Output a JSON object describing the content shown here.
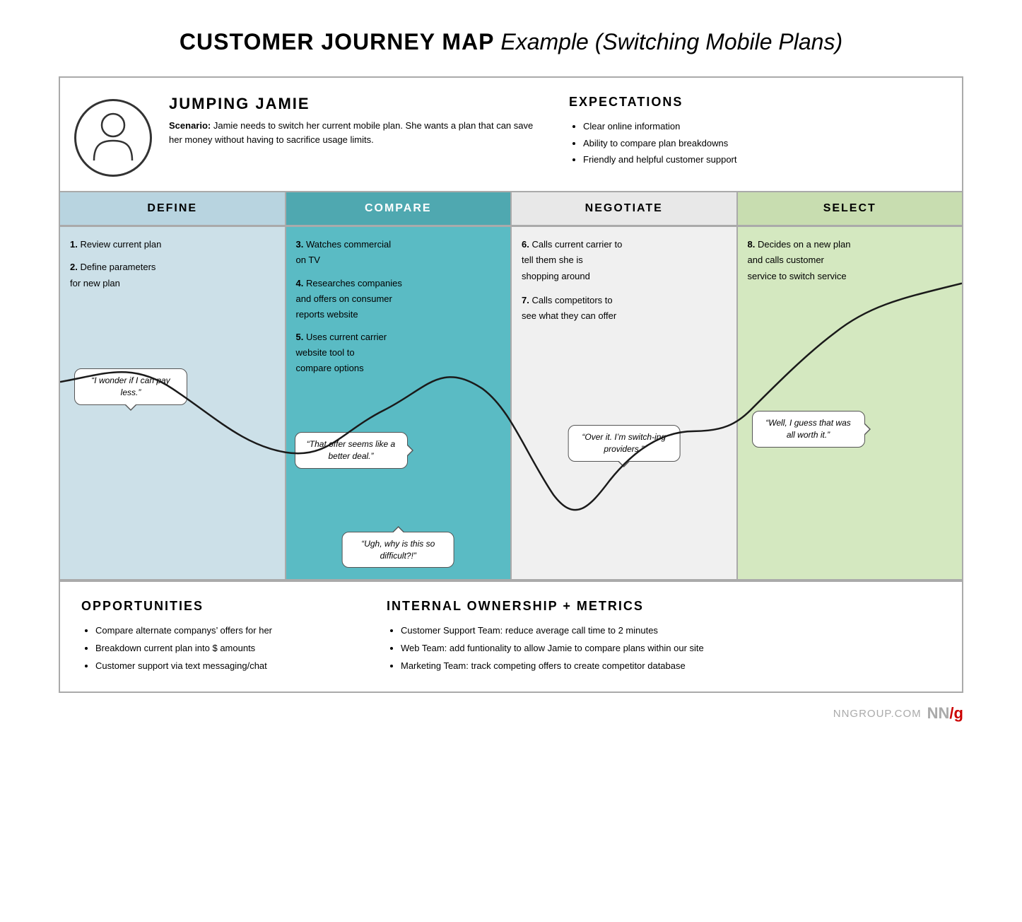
{
  "title": {
    "bold": "CUSTOMER JOURNEY MAP",
    "italic": "Example (Switching Mobile Plans)"
  },
  "persona": {
    "name": "JUMPING JAMIE",
    "scenario_label": "Scenario:",
    "scenario_text": "Jamie needs to switch her current mobile plan. She wants a plan that can save her money without having to sacrifice usage limits."
  },
  "expectations": {
    "title": "EXPECTATIONS",
    "items": [
      "Clear online information",
      "Ability to compare plan breakdowns",
      "Friendly and helpful customer support"
    ]
  },
  "phases": [
    {
      "id": "define",
      "label": "DEFINE",
      "steps": [
        {
          "num": "1.",
          "text": "Review current plan"
        },
        {
          "num": "2.",
          "text": "Define parameters for new plan"
        }
      ],
      "bubble": "“I wonder if I can pay less.”",
      "bubble_pos": "top-left"
    },
    {
      "id": "compare",
      "label": "COMPARE",
      "steps": [
        {
          "num": "3.",
          "text": "Watches commercial on TV"
        },
        {
          "num": "4.",
          "text": "Researches companies and offers on consumer reports website"
        },
        {
          "num": "5.",
          "text": "Uses current carrier website tool to compare options"
        }
      ],
      "bubble_top": "“That offer seems like a better deal.”",
      "bubble_bottom": "“Ugh, why is this so difficult?!”"
    },
    {
      "id": "negotiate",
      "label": "NEGOTIATE",
      "steps": [
        {
          "num": "6.",
          "text": "Calls current carrier to tell them she is shopping around"
        },
        {
          "num": "7.",
          "text": "Calls competitors to see what they can offer"
        }
      ],
      "bubble": "“Over it. I’m switch-ing providers.”"
    },
    {
      "id": "select",
      "label": "SELECT",
      "steps": [
        {
          "num": "8.",
          "text": "Decides on a new plan and calls customer service to switch service"
        }
      ],
      "bubble": "“Well, I guess that was all worth it.”"
    }
  ],
  "opportunities": {
    "title": "OPPORTUNITIES",
    "items": [
      "Compare alternate companys’ offers for her",
      "Breakdown current plan into $ amounts",
      "Customer support via text messaging/chat"
    ]
  },
  "internal": {
    "title": "INTERNAL OWNERSHIP + METRICS",
    "items": [
      "Customer Support Team: reduce average call time to 2 minutes",
      "Web Team: add funtionality to allow Jamie to compare plans within our site",
      "Marketing Team: track competing offers to create competitor database"
    ]
  },
  "footer": {
    "text": "NNGROUP.COM",
    "logo": "NN/g"
  }
}
